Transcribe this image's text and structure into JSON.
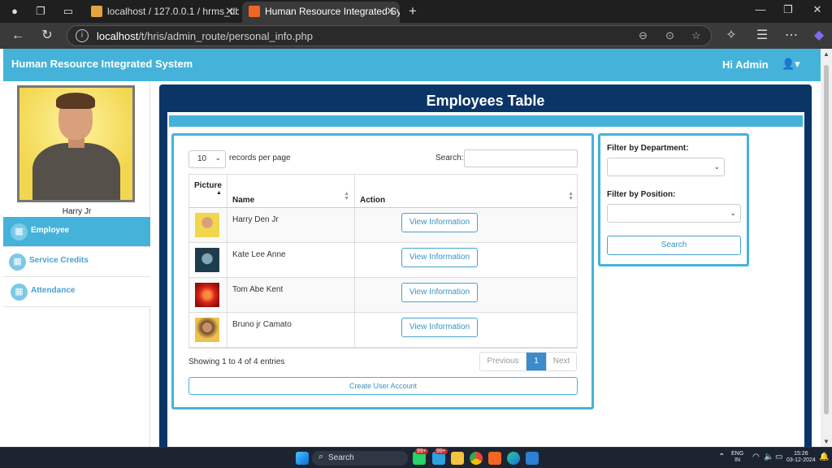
{
  "browser": {
    "tabs": [
      {
        "title": "localhost / 127.0.0.1 / hrms_db / u",
        "active": false
      },
      {
        "title": "Human Resource Integrated Syste",
        "active": true
      }
    ],
    "url_host": "localhost",
    "url_path": "/t/hris/admin_route/personal_info.php",
    "new_tab_icon": "plus-icon"
  },
  "app": {
    "title": "Human Resource Integrated System",
    "greeting": "Hi Admin",
    "accent_color": "#45b3d9",
    "panel_color": "#0b3566"
  },
  "sidebar": {
    "user_name": "Harry Jr",
    "items": [
      {
        "label": "Employee",
        "icon": "table-icon",
        "active": true
      },
      {
        "label": "Service Credits",
        "icon": "table-icon",
        "active": false
      },
      {
        "label": "Attendance",
        "icon": "table-icon",
        "active": false
      }
    ]
  },
  "main": {
    "title": "Employees Table",
    "length_value": "10",
    "length_label": "records per page",
    "search_label": "Search:",
    "columns": [
      "Picture",
      "Name",
      "Action"
    ],
    "rows": [
      {
        "name": "Harry Den Jr",
        "action": "View Information"
      },
      {
        "name": "Kate Lee Anne",
        "action": "View Information"
      },
      {
        "name": "Tom Abe Kent",
        "action": "View Information"
      },
      {
        "name": "Bruno jr Camato",
        "action": "View Information"
      }
    ],
    "info": "Showing 1 to 4 of 4 entries",
    "pagination": {
      "previous": "Previous",
      "current": "1",
      "next": "Next"
    },
    "create_button": "Create User Account"
  },
  "filters": {
    "department_label": "Filter by Department:",
    "position_label": "Filter by Position:",
    "search_button": "Search"
  },
  "taskbar": {
    "search_text": "Search",
    "badge": "99+",
    "lang_top": "ENG",
    "lang_bottom": "IN",
    "time": "15:26",
    "date": "03-12-2024"
  }
}
